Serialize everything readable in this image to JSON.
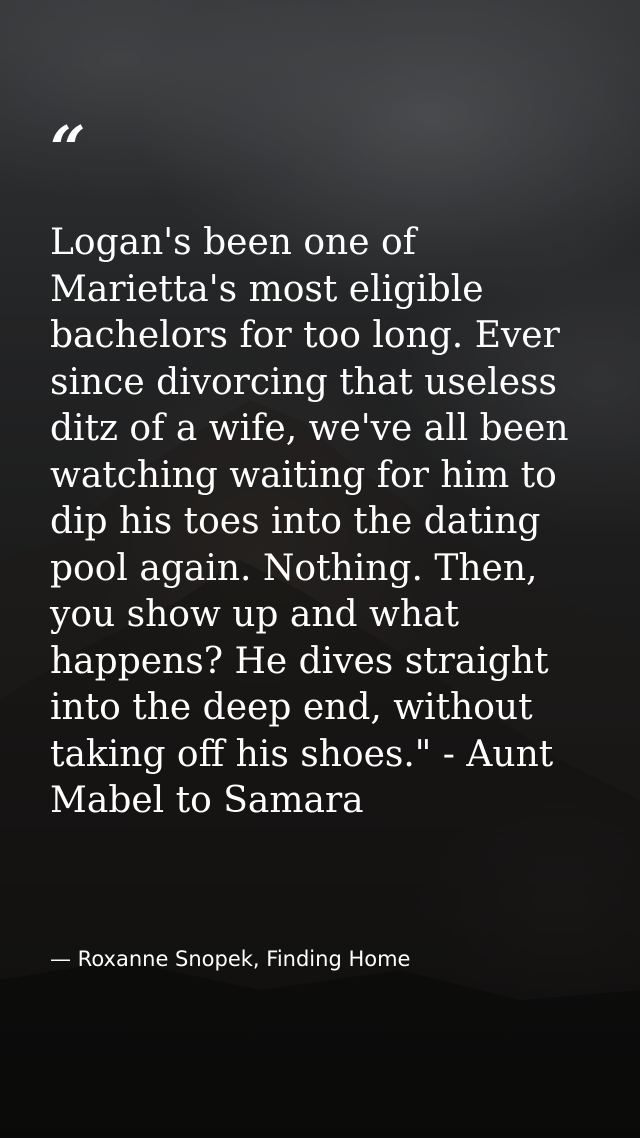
{
  "quote": {
    "mark": "“",
    "text": "Logan's been one of Marietta's most eligible bachelors for too long. Ever since divorcing that useless ditz of a wife, we've all been watching waiting for him to dip his toes into the dating pool again. Nothing. Then, you show up and what happens? He dives straight into the deep end, without taking off his shoes.\" - Aunt Mabel to Samara",
    "attribution": "— Roxanne Snopek, Finding Home"
  },
  "colors": {
    "text": "#ffffff",
    "background": "#1b1b1c"
  }
}
